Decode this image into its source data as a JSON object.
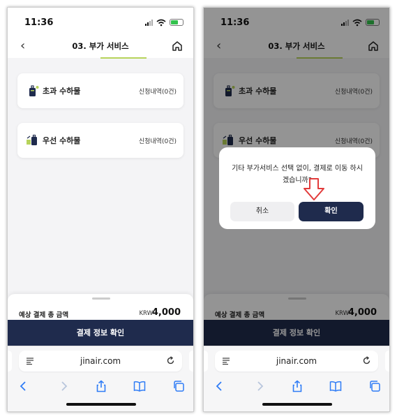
{
  "status": {
    "time": "11:36"
  },
  "header": {
    "title": "03. 부가 서비스"
  },
  "services": [
    {
      "title": "초과 수하물",
      "meta": "신청내역(0건)",
      "icon": "luggage-icon"
    },
    {
      "title": "우선 수하물",
      "meta": "신청내역(0건)",
      "icon": "priority-baggage-icon"
    }
  ],
  "summary": {
    "label": "예상 결제 총 금액",
    "currency": "KRW",
    "amount": "4,000"
  },
  "cta": {
    "label": "결제 정보 확인"
  },
  "browser": {
    "url": "jinair.com"
  },
  "dialog": {
    "message": "기타 부가서비스 선택 없이, 결제로 이동 하시겠습니까?",
    "cancel_label": "취소",
    "confirm_label": "확인"
  },
  "colors": {
    "brand_navy": "#1f2b4d",
    "accent_green": "#b7d35b",
    "annotation_arrow": "#e23b3b"
  }
}
